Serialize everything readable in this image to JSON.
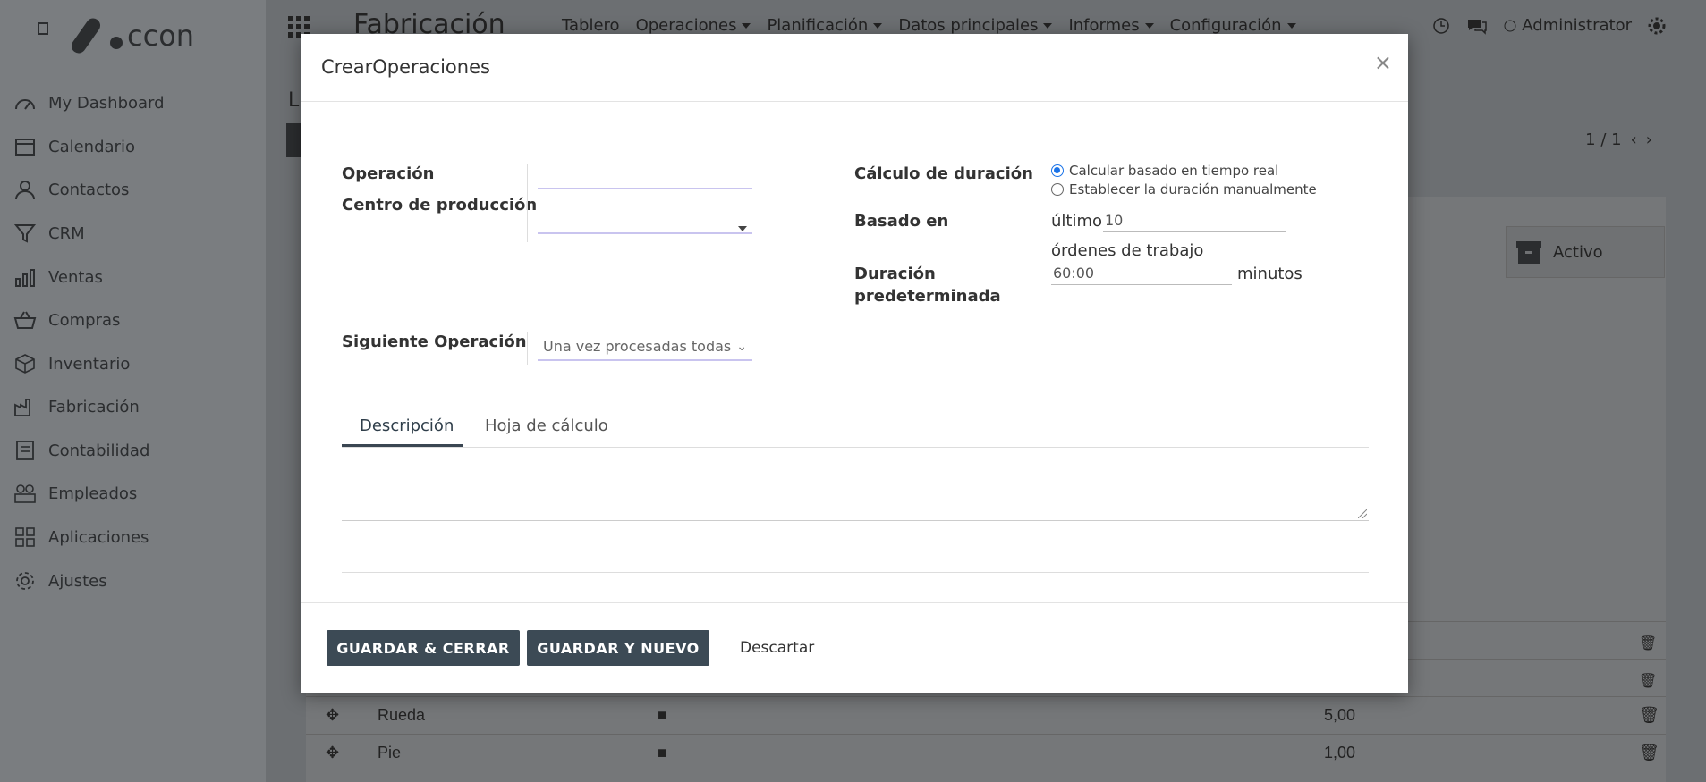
{
  "app": {
    "title": "Fabricación",
    "user": "Administrator",
    "nav": [
      "Tablero",
      "Operaciones",
      "Planificación",
      "Datos principales",
      "Informes",
      "Configuración"
    ],
    "pager": "1 / 1",
    "archive_label": "Activo"
  },
  "sidebar": {
    "items": [
      {
        "label": "My Dashboard",
        "icon": "dashboard-icon"
      },
      {
        "label": "Calendario",
        "icon": "calendar-icon"
      },
      {
        "label": "Contactos",
        "icon": "user-icon"
      },
      {
        "label": "CRM",
        "icon": "funnel-icon"
      },
      {
        "label": "Ventas",
        "icon": "bar-chart-icon"
      },
      {
        "label": "Compras",
        "icon": "basket-icon"
      },
      {
        "label": "Inventario",
        "icon": "box-icon"
      },
      {
        "label": "Fabricación",
        "icon": "factory-icon"
      },
      {
        "label": "Contabilidad",
        "icon": "ledger-icon"
      },
      {
        "label": "Empleados",
        "icon": "people-icon"
      },
      {
        "label": "Aplicaciones",
        "icon": "apps-grid-icon"
      },
      {
        "label": "Ajustes",
        "icon": "gear-icon"
      }
    ]
  },
  "background_rows": [
    {
      "name": "Rueda",
      "value": "5,00"
    },
    {
      "name": "Pie",
      "value": "1,00"
    }
  ],
  "modal": {
    "title": "CrearOperaciones",
    "fields": {
      "operacion_label": "Operación",
      "centro_label": "Centro de producción",
      "siguiente_label": "Siguiente Operación",
      "siguiente_value": "Una vez procesadas todas las unida",
      "calculo_label": "Cálculo de duración",
      "calculo_options": [
        "Calcular basado en tiempo real",
        "Establecer la duración manualmente"
      ],
      "calculo_selected": 0,
      "basado_label": "Basado en",
      "basado_prefix": "último",
      "basado_value": "10",
      "basado_suffix": "órdenes de trabajo",
      "duracion_label_1": "Duración",
      "duracion_label_2": "predeterminada",
      "duracion_value": "60:00",
      "duracion_unit": "minutos"
    },
    "tabs": [
      "Descripción",
      "Hoja de cálculo"
    ],
    "active_tab": 0,
    "buttons": {
      "save_close": "GUARDAR & CERRAR",
      "save_new": "GUARDAR Y NUEVO",
      "discard": "Descartar"
    }
  },
  "colors": {
    "accent": "#3c4a55",
    "focus_line": "#c9c4ef",
    "radio_on": "#1a73e8"
  }
}
